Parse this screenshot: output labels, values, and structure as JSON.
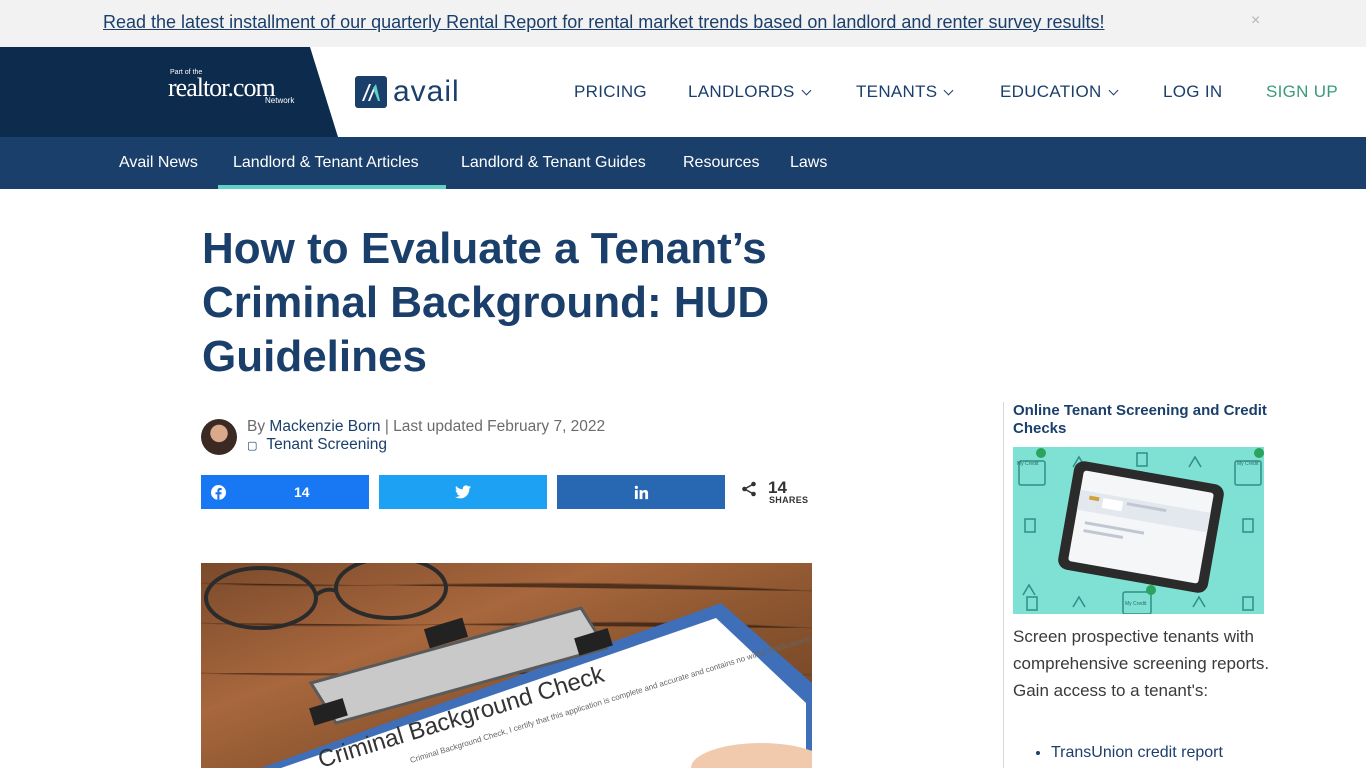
{
  "announcement": {
    "text": "Read the latest installment of our quarterly Rental Report for rental market trends based on landlord and renter survey results!",
    "close": "×"
  },
  "header": {
    "realtor": {
      "part_of": "Part of the",
      "name": "realtor.com",
      "network": "Network"
    },
    "avail": {
      "name": "avail"
    },
    "nav": {
      "pricing": "PRICING",
      "landlords": "LANDLORDS",
      "tenants": "TENANTS",
      "education": "EDUCATION",
      "login": "LOG IN",
      "signup": "SIGN UP"
    }
  },
  "subnav": {
    "items": [
      "Avail News",
      "Landlord & Tenant Articles",
      "Landlord & Tenant Guides",
      "Resources",
      "Laws"
    ],
    "active": "Landlord & Tenant Articles"
  },
  "article": {
    "title": "How to Evaluate a Tenant’s Criminal Background: HUD Guidelines",
    "by": "By",
    "author": "Mackenzie Born",
    "updated": " | Last updated February 7, 2022",
    "category": "Tenant Screening",
    "share": {
      "facebook_count": "14",
      "total": "14",
      "total_label": "SHARES"
    },
    "hero_text": "Criminal Background Check",
    "hero_fine_print": "Criminal Background Check, I certify that this application is complete and accurate and contains no willful falsifications or misrepresentations, or omissions may disqualify me"
  },
  "sidebar": {
    "title": "Online Tenant Screening and Credit Checks",
    "img_label": "My Credit",
    "text": "Screen prospective tenants with comprehensive screening reports. Gain access to a tenant's:",
    "list": [
      "TransUnion credit report"
    ]
  },
  "colors": {
    "navy": "#1b3f6b",
    "dark_navy": "#0d2b4c",
    "teal": "#5fd1c5",
    "signup_green": "#3a9b7a",
    "facebook": "#1877f2",
    "twitter": "#1da1f2",
    "linkedin": "#2867b2"
  }
}
